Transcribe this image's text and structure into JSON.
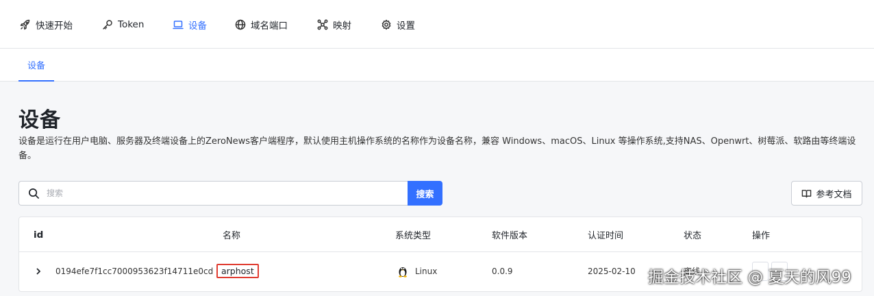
{
  "nav": {
    "items": [
      {
        "label": "快速开始",
        "icon": "rocket-icon"
      },
      {
        "label": "Token",
        "icon": "key-icon"
      },
      {
        "label": "设备",
        "icon": "laptop-icon",
        "active": true
      },
      {
        "label": "域名端口",
        "icon": "globe-icon"
      },
      {
        "label": "映射",
        "icon": "network-icon"
      },
      {
        "label": "设置",
        "icon": "gear-icon"
      }
    ]
  },
  "subnav": {
    "tab": "设备"
  },
  "page": {
    "title": "设备",
    "description": "设备是运行在用户电脑、服务器及终端设备上的ZeroNews客户端程序，默认使用主机操作系统的名称作为设备名称，兼容 Windows、macOS、Linux 等操作系统,支持NAS、Openwrt、树莓派、软路由等终端设备。"
  },
  "search": {
    "placeholder": "搜索",
    "button": "搜索",
    "icon": "search-icon"
  },
  "docs_button": {
    "label": "参考文档",
    "icon": "book-icon"
  },
  "table": {
    "headers": [
      "id",
      "名称",
      "系统类型",
      "软件版本",
      "认证时间",
      "状态",
      "操作"
    ],
    "rows": [
      {
        "id": "0194efe7f1cc7000953623f14711e0cd",
        "name": "arphost",
        "os": "Linux",
        "os_icon": "linux-penguin-icon",
        "version": "0.0.9",
        "auth_time": "2025-02-10",
        "status": "离线"
      }
    ]
  },
  "watermark": "掘金技术社区 @ 夏天的风99",
  "colors": {
    "accent": "#3370ff",
    "highlight_border": "#e03c31"
  }
}
